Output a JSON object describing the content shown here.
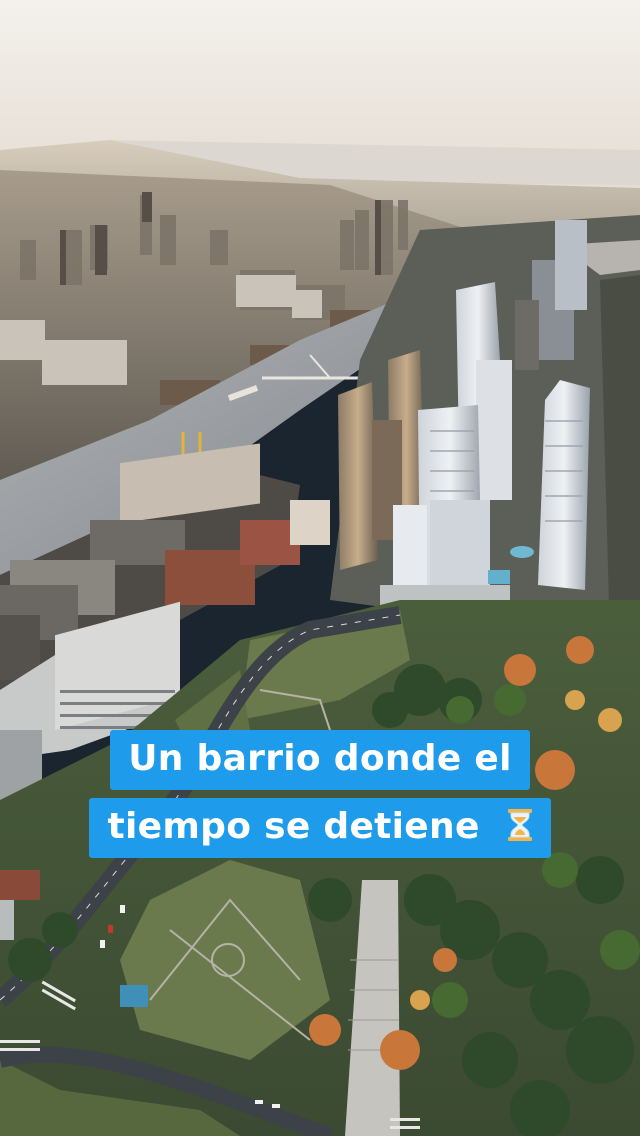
{
  "caption": {
    "line1": "Un barrio donde el",
    "line2": "tiempo se detiene",
    "trailing_icon": "hourglass-icon",
    "box_color": "#1e9bea",
    "text_color": "#ffffff"
  },
  "palette": {
    "sky_top": "#f3efe8",
    "sky_horizon": "#e9e4dc",
    "river": "#8f96a0",
    "park_green": "#3f5a36",
    "tree_green": "#2f4a2a",
    "autumn_orange": "#c8763a",
    "road_gray": "#3a3f46"
  }
}
